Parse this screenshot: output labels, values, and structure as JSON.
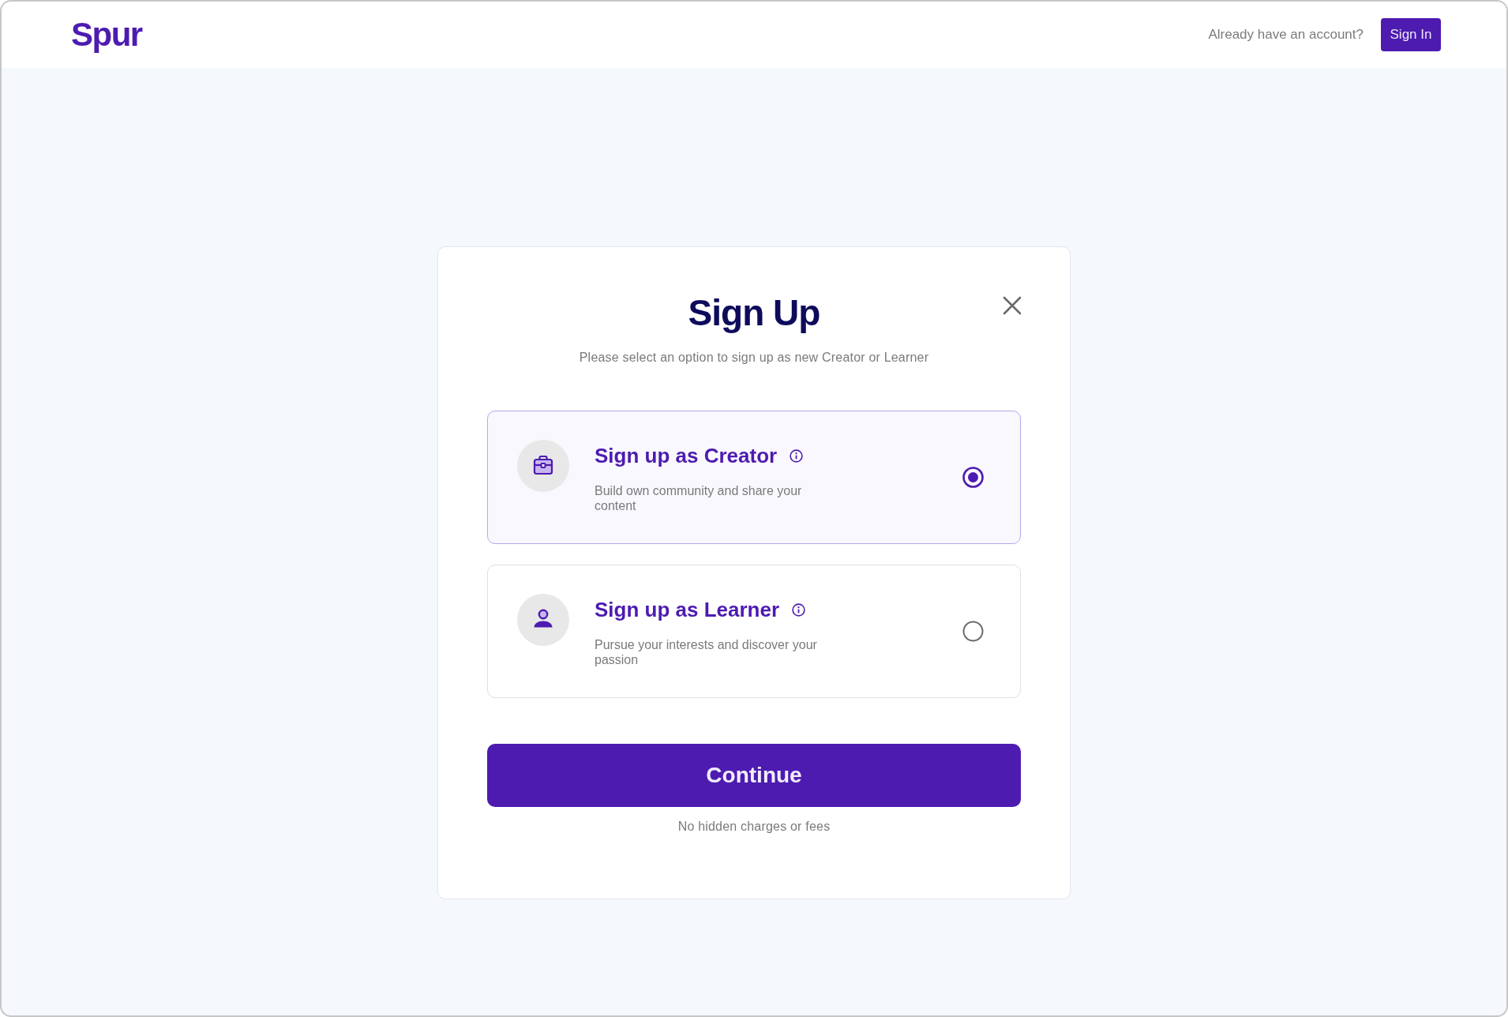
{
  "header": {
    "logo": "Spur",
    "prompt": "Already have an account?",
    "sign_in_button": "Sign In"
  },
  "dialog": {
    "title": "Sign Up",
    "subtitle": "Please select an option to sign up as new Creator or Learner",
    "options": [
      {
        "kind": "creator",
        "title": "Sign up as Creator",
        "description": "Build own community and share your content",
        "selected": true
      },
      {
        "kind": "learner",
        "title": "Sign up as Learner",
        "description": "Pursue your interests and discover your passion",
        "selected": false
      }
    ],
    "continue_button": "Continue",
    "note": "No hidden charges or fees"
  }
}
